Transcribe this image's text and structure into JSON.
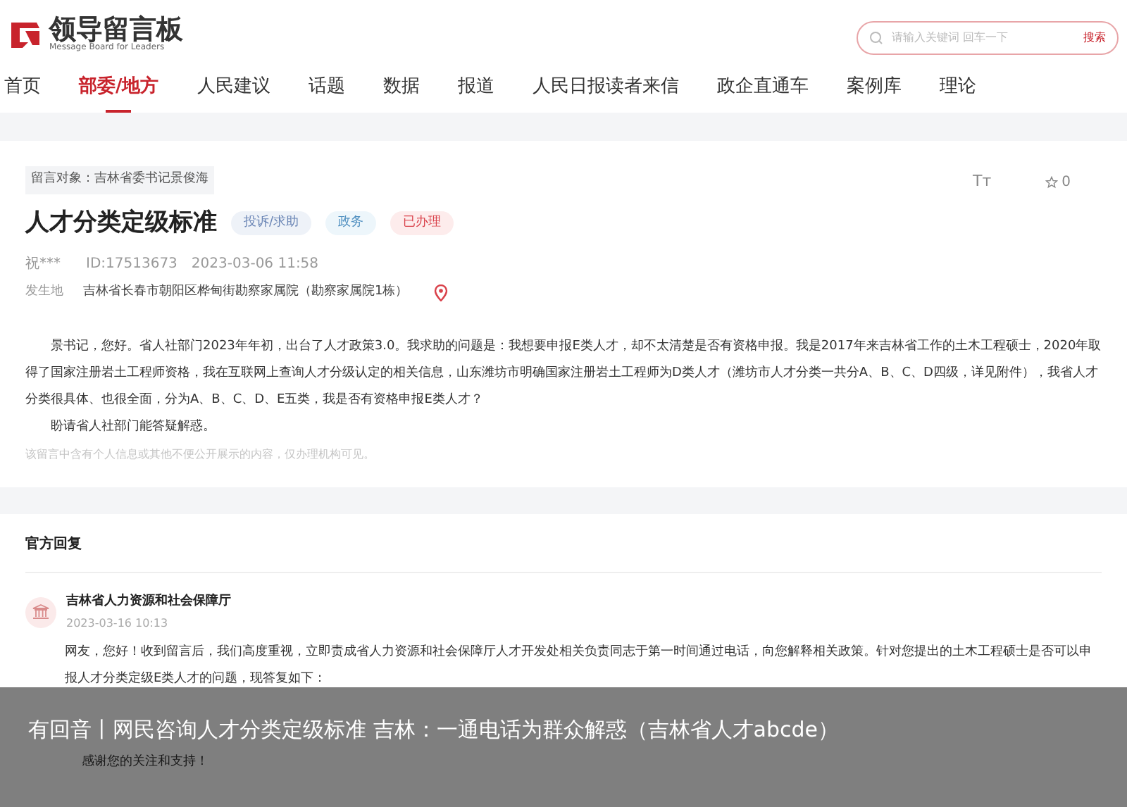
{
  "header": {
    "logo_title": "领导留言板",
    "logo_subtitle": "Message Board for Leaders",
    "search": {
      "placeholder": "请输入关键词 回车一下",
      "button": "搜索"
    }
  },
  "nav": [
    {
      "label": "首页",
      "selected": false
    },
    {
      "label": "部委/地方",
      "selected": true
    },
    {
      "label": "人民建议",
      "selected": false
    },
    {
      "label": "话题",
      "selected": false
    },
    {
      "label": "数据",
      "selected": false
    },
    {
      "label": "报道",
      "selected": false
    },
    {
      "label": "人民日报读者来信",
      "selected": false
    },
    {
      "label": "政企直通车",
      "selected": false
    },
    {
      "label": "案例库",
      "selected": false
    },
    {
      "label": "理论",
      "selected": false
    }
  ],
  "message": {
    "target": "留言对象：吉林省委书记景俊海",
    "title": "人才分类定级标准",
    "tags": [
      {
        "label": "投诉/求助",
        "kind": "type"
      },
      {
        "label": "政务",
        "kind": "domain"
      },
      {
        "label": "已办理",
        "kind": "status"
      }
    ],
    "font_button": "Tт",
    "favorite_count": "0",
    "author": "祝***",
    "id": "ID:17513673",
    "time": "2023-03-06 11:58",
    "location_label": "发生地",
    "location": "吉林省长春市朝阳区桦甸街勘察家属院（勘察家属院1栋）",
    "paragraphs": [
      "景书记，您好。省人社部门2023年年初，出台了人才政策3.0。我求助的问题是：我想要申报E类人才，却不太清楚是否有资格申报。我是2017年来吉林省工作的土木工程硕士，2020年取得了国家注册岩土工程师资格，我在互联网上查询人才分级认定的相关信息，山东潍坊市明确国家注册岩土工程师为D类人才（潍坊市人才分类一共分A、B、C、D四级，详见附件），我省人才分类很具体、也很全面，分为A、B、C、D、E五类，我是否有资格申报E类人才？",
      "盼请省人社部门能答疑解惑。"
    ],
    "privacy_note": "该留言中含有个人信息或其他不便公开展示的内容，仅办理机构可见。"
  },
  "reply": {
    "heading": "官方回复",
    "department": "吉林省人力资源和社会保障厅",
    "time": "2023-03-16 10:13",
    "paragraphs": [
      "网友，您好！收到留言后，我们高度重视，立即责成省人力资源和社会保障厅人才开发处相关负责同志于第一时间通过电话，向您解释相关政策。针对您提出的土木工程硕士是否可以申报人才分类定级E类人才的问题，现答复如下：",
      "感谢您的关注和支持！"
    ]
  },
  "caption": "有回音丨网民咨询人才分类定级标准 吉林：一通电话为群众解惑（吉林省人才abcde）"
}
